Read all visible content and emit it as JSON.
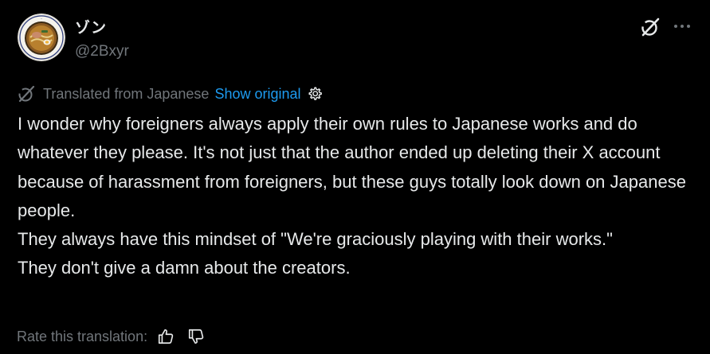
{
  "author": {
    "display_name": "ゾン",
    "handle": "@2Bxyr",
    "avatar_icon": "ramen-bowl-avatar"
  },
  "header_actions": {
    "grok_icon": "grok-icon",
    "more_icon": "more-icon"
  },
  "translation": {
    "label": "Translated from Japanese",
    "show_original": "Show original",
    "link_color": "#1d9bf0"
  },
  "tweet": {
    "lines": [
      "I wonder why foreigners always apply their own rules to Japanese works and do whatever they please. It's not just that the author ended up deleting their X account because of harassment from foreigners, but these guys totally look down on Japanese people.",
      "They always have this mindset of \"We're graciously playing with their works.\"",
      "They don't give a damn about the creators."
    ]
  },
  "rating": {
    "label": "Rate this translation:"
  }
}
